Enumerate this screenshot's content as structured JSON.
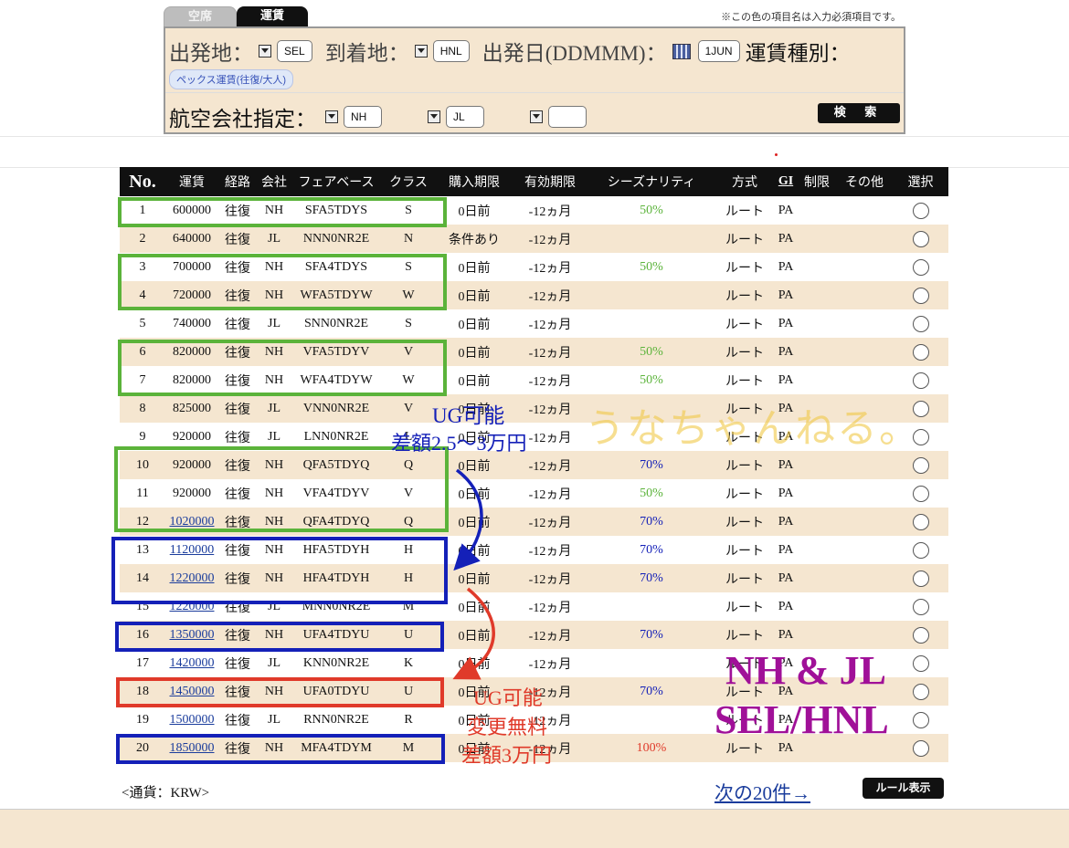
{
  "tabs": [
    {
      "label": "空席",
      "active": false
    },
    {
      "label": "運賃",
      "active": true
    }
  ],
  "required_note": "※この色の項目名は入力必須項目です。",
  "search": {
    "origin_label": "出発地：",
    "origin_value": "SEL",
    "destination_label": "到着地：",
    "destination_value": "HNL",
    "date_label": "出発日(DDMMM)：",
    "date_value": "1JUN",
    "fare_type_label": "運賃種別：",
    "fare_type_value": "ペックス運賃(往復/大人)",
    "airline_label": "航空会社指定：",
    "airline_1": "NH",
    "airline_2": "JL",
    "airline_3": "",
    "search_button": "検 索"
  },
  "table": {
    "headers": [
      "No.",
      "運賃",
      "経路",
      "会社",
      "フェアベース",
      "クラス",
      "購入期限",
      "有効期限",
      "シーズナリティ",
      "方式",
      "GI",
      "制限",
      "その他",
      "選択"
    ],
    "rows": [
      {
        "no": "1",
        "fare": "600000",
        "linked": false,
        "route": "往復",
        "carrier": "NH",
        "fare_basis": "SFA5TDYS",
        "class": "S",
        "purchase": "0日前",
        "validity": "-12ヵ月",
        "season": "50%",
        "season_color": "#5bb33a",
        "method": "ルート",
        "gi": "PA"
      },
      {
        "no": "2",
        "fare": "640000",
        "linked": false,
        "route": "往復",
        "carrier": "JL",
        "fare_basis": "NNN0NR2E",
        "class": "N",
        "purchase": "条件あり",
        "validity": "-12ヵ月",
        "season": "",
        "season_color": "",
        "method": "ルート",
        "gi": "PA"
      },
      {
        "no": "3",
        "fare": "700000",
        "linked": false,
        "route": "往復",
        "carrier": "NH",
        "fare_basis": "SFA4TDYS",
        "class": "S",
        "purchase": "0日前",
        "validity": "-12ヵ月",
        "season": "50%",
        "season_color": "#5bb33a",
        "method": "ルート",
        "gi": "PA"
      },
      {
        "no": "4",
        "fare": "720000",
        "linked": false,
        "route": "往復",
        "carrier": "NH",
        "fare_basis": "WFA5TDYW",
        "class": "W",
        "purchase": "0日前",
        "validity": "-12ヵ月",
        "season": "",
        "season_color": "",
        "method": "ルート",
        "gi": "PA"
      },
      {
        "no": "5",
        "fare": "740000",
        "linked": false,
        "route": "往復",
        "carrier": "JL",
        "fare_basis": "SNN0NR2E",
        "class": "S",
        "purchase": "0日前",
        "validity": "-12ヵ月",
        "season": "",
        "season_color": "",
        "method": "ルート",
        "gi": "PA"
      },
      {
        "no": "6",
        "fare": "820000",
        "linked": false,
        "route": "往復",
        "carrier": "NH",
        "fare_basis": "VFA5TDYV",
        "class": "V",
        "purchase": "0日前",
        "validity": "-12ヵ月",
        "season": "50%",
        "season_color": "#5bb33a",
        "method": "ルート",
        "gi": "PA"
      },
      {
        "no": "7",
        "fare": "820000",
        "linked": false,
        "route": "往復",
        "carrier": "NH",
        "fare_basis": "WFA4TDYW",
        "class": "W",
        "purchase": "0日前",
        "validity": "-12ヵ月",
        "season": "50%",
        "season_color": "#5bb33a",
        "method": "ルート",
        "gi": "PA"
      },
      {
        "no": "8",
        "fare": "825000",
        "linked": false,
        "route": "往復",
        "carrier": "JL",
        "fare_basis": "VNN0NR2E",
        "class": "V",
        "purchase": "0日前",
        "validity": "-12ヵ月",
        "season": "",
        "season_color": "",
        "method": "ルート",
        "gi": "PA"
      },
      {
        "no": "9",
        "fare": "920000",
        "linked": false,
        "route": "往復",
        "carrier": "JL",
        "fare_basis": "LNN0NR2E",
        "class": "L",
        "purchase": "0日前",
        "validity": "-12ヵ月",
        "season": "",
        "season_color": "",
        "method": "ルート",
        "gi": "PA"
      },
      {
        "no": "10",
        "fare": "920000",
        "linked": false,
        "route": "往復",
        "carrier": "NH",
        "fare_basis": "QFA5TDYQ",
        "class": "Q",
        "purchase": "0日前",
        "validity": "-12ヵ月",
        "season": "70%",
        "season_color": "#1420b8",
        "method": "ルート",
        "gi": "PA"
      },
      {
        "no": "11",
        "fare": "920000",
        "linked": false,
        "route": "往復",
        "carrier": "NH",
        "fare_basis": "VFA4TDYV",
        "class": "V",
        "purchase": "0日前",
        "validity": "-12ヵ月",
        "season": "50%",
        "season_color": "#5bb33a",
        "method": "ルート",
        "gi": "PA"
      },
      {
        "no": "12",
        "fare": "1020000",
        "linked": true,
        "route": "往復",
        "carrier": "NH",
        "fare_basis": "QFA4TDYQ",
        "class": "Q",
        "purchase": "0日前",
        "validity": "-12ヵ月",
        "season": "70%",
        "season_color": "#1420b8",
        "method": "ルート",
        "gi": "PA"
      },
      {
        "no": "13",
        "fare": "1120000",
        "linked": true,
        "route": "往復",
        "carrier": "NH",
        "fare_basis": "HFA5TDYH",
        "class": "H",
        "purchase": "0日前",
        "validity": "-12ヵ月",
        "season": "70%",
        "season_color": "#1420b8",
        "method": "ルート",
        "gi": "PA"
      },
      {
        "no": "14",
        "fare": "1220000",
        "linked": true,
        "route": "往復",
        "carrier": "NH",
        "fare_basis": "HFA4TDYH",
        "class": "H",
        "purchase": "0日前",
        "validity": "-12ヵ月",
        "season": "70%",
        "season_color": "#1420b8",
        "method": "ルート",
        "gi": "PA"
      },
      {
        "no": "15",
        "fare": "1220000",
        "linked": true,
        "route": "往復",
        "carrier": "JL",
        "fare_basis": "MNN0NR2E",
        "class": "M",
        "purchase": "0日前",
        "validity": "-12ヵ月",
        "season": "",
        "season_color": "",
        "method": "ルート",
        "gi": "PA"
      },
      {
        "no": "16",
        "fare": "1350000",
        "linked": true,
        "route": "往復",
        "carrier": "NH",
        "fare_basis": "UFA4TDYU",
        "class": "U",
        "purchase": "0日前",
        "validity": "-12ヵ月",
        "season": "70%",
        "season_color": "#1420b8",
        "method": "ルート",
        "gi": "PA"
      },
      {
        "no": "17",
        "fare": "1420000",
        "linked": true,
        "route": "往復",
        "carrier": "JL",
        "fare_basis": "KNN0NR2E",
        "class": "K",
        "purchase": "0日前",
        "validity": "-12ヵ月",
        "season": "",
        "season_color": "",
        "method": "ルート",
        "gi": "PA"
      },
      {
        "no": "18",
        "fare": "1450000",
        "linked": true,
        "route": "往復",
        "carrier": "NH",
        "fare_basis": "UFA0TDYU",
        "class": "U",
        "purchase": "0日前",
        "validity": "-12ヵ月",
        "season": "70%",
        "season_color": "#1420b8",
        "method": "ルート",
        "gi": "PA"
      },
      {
        "no": "19",
        "fare": "1500000",
        "linked": true,
        "route": "往復",
        "carrier": "JL",
        "fare_basis": "RNN0NR2E",
        "class": "R",
        "purchase": "0日前",
        "validity": "-12ヵ月",
        "season": "",
        "season_color": "",
        "method": "ルート",
        "gi": "PA"
      },
      {
        "no": "20",
        "fare": "1850000",
        "linked": true,
        "route": "往復",
        "carrier": "NH",
        "fare_basis": "MFA4TDYM",
        "class": "M",
        "purchase": "0日前",
        "validity": "-12ヵ月",
        "season": "100%",
        "season_color": "#e03a2a",
        "method": "ルート",
        "gi": "PA"
      }
    ]
  },
  "footer": {
    "currency": "<通貨：KRW>",
    "next_link": "次の20件→",
    "rules_button": "ルール表示"
  },
  "annotations": {
    "ug_blue_1": "UG可能",
    "ug_blue_2": "差額2.5〜3万円",
    "ug_red_1": "UG可能",
    "ug_red_2": "変更無料",
    "ug_red_3": "差額3万円",
    "watermark": "うなちゃんねる。",
    "route_1": "NH & JL",
    "route_2": "SEL/HNL"
  },
  "colors": {
    "green": "#5bb33a",
    "blue": "#1420b8",
    "red": "#e03a2a",
    "purple": "#a01098",
    "panel": "#f5e6d0"
  }
}
